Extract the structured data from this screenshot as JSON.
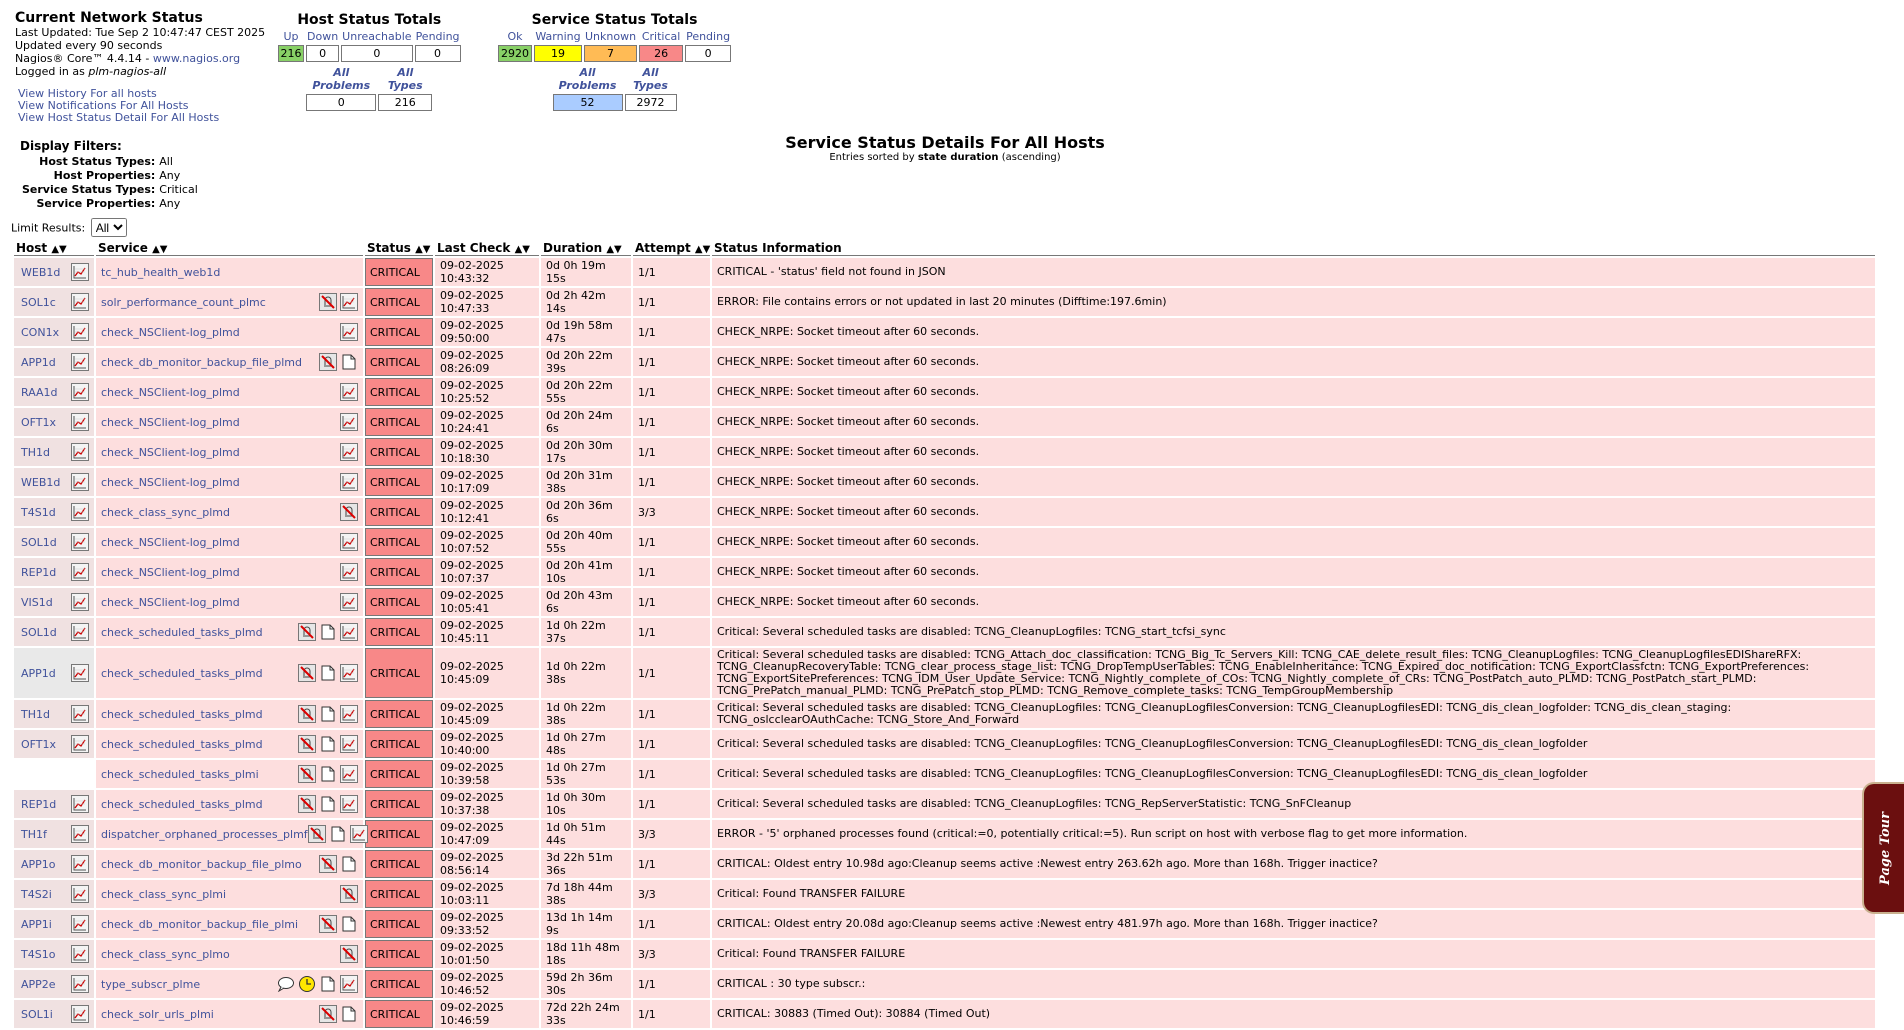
{
  "info": {
    "title": "Current Network Status",
    "last_updated": "Last Updated: Tue Sep 2 10:47:47 CEST 2025",
    "update_every": "Updated every 90 seconds",
    "version_prefix": "Nagios® Core™ 4.4.14 - ",
    "version_link": "www.nagios.org",
    "logged_prefix": "Logged in as ",
    "logged_user": "plm-nagios-all"
  },
  "links": [
    "View History For all hosts",
    "View Notifications For All Hosts",
    "View Host Status Detail For All Hosts"
  ],
  "host_totals": {
    "title": "Host Status Totals",
    "headers": [
      "Up",
      "Down",
      "Unreachable",
      "Pending"
    ],
    "values": [
      "216",
      "0",
      "0",
      "0"
    ],
    "sub_headers": [
      "All Problems",
      "All Types"
    ],
    "sub_values": [
      "0",
      "216"
    ]
  },
  "service_totals": {
    "title": "Service Status Totals",
    "headers": [
      "Ok",
      "Warning",
      "Unknown",
      "Critical",
      "Pending"
    ],
    "values": [
      "2920",
      "19",
      "7",
      "26",
      "0"
    ],
    "sub_headers": [
      "All Problems",
      "All Types"
    ],
    "sub_values": [
      "52",
      "2972"
    ]
  },
  "colors": {
    "ok": "#88d066",
    "warning": "#ffff00",
    "unknown": "#ffbb55",
    "critical": "#f88888",
    "problems": "#aaccff",
    "row_bg": "#fddede"
  },
  "filters": {
    "title": "Display Filters:",
    "rows": [
      {
        "k": "Host Status Types:",
        "v": "All"
      },
      {
        "k": "Host Properties:",
        "v": "Any"
      },
      {
        "k": "Service Status Types:",
        "v": "Critical"
      },
      {
        "k": "Service Properties:",
        "v": "Any"
      }
    ]
  },
  "heading": {
    "title": "Service Status Details For All Hosts",
    "sort_prefix": "Entries sorted by ",
    "sort_field": "state duration",
    "sort_suffix": " (ascending)"
  },
  "limit": {
    "label": "Limit Results:",
    "selected": "All"
  },
  "columns": [
    "Host",
    "Service",
    "Status",
    "Last Check",
    "Duration",
    "Attempt",
    "Status Information"
  ],
  "rows": [
    {
      "host": "WEB1d",
      "service": "tc_hub_health_web1d",
      "icons": [],
      "last": "09-02-2025 10:43:32",
      "dur": "0d 0h 19m 15s",
      "att": "1/1",
      "info": "CRITICAL - 'status' field not found in JSON",
      "hostbg": ""
    },
    {
      "host": "SOL1c",
      "service": "solr_performance_count_plmc",
      "icons": [
        "nonotif",
        "graph"
      ],
      "last": "09-02-2025 10:47:33",
      "dur": "0d 2h 42m 14s",
      "att": "1/1",
      "info": "ERROR: File contains errors or not updated in last 20 minutes (Difftime:197.6min)",
      "hostbg": ""
    },
    {
      "host": "CON1x",
      "service": "check_NSClient-log_plmd",
      "icons": [
        "graph"
      ],
      "last": "09-02-2025 09:50:00",
      "dur": "0d 19h 58m 47s",
      "att": "1/1",
      "info": "CHECK_NRPE: Socket timeout after 60 seconds.",
      "hostbg": ""
    },
    {
      "host": "APP1d",
      "service": "check_db_monitor_backup_file_plmd",
      "icons": [
        "nonotif",
        "doc"
      ],
      "last": "09-02-2025 08:26:09",
      "dur": "0d 20h 22m 39s",
      "att": "1/1",
      "info": "CHECK_NRPE: Socket timeout after 60 seconds.",
      "hostbg": ""
    },
    {
      "host": "RAA1d",
      "service": "check_NSClient-log_plmd",
      "icons": [
        "graph"
      ],
      "last": "09-02-2025 10:25:52",
      "dur": "0d 20h 22m 55s",
      "att": "1/1",
      "info": "CHECK_NRPE: Socket timeout after 60 seconds.",
      "hostbg": ""
    },
    {
      "host": "OFT1x",
      "service": "check_NSClient-log_plmd",
      "icons": [
        "graph"
      ],
      "last": "09-02-2025 10:24:41",
      "dur": "0d 20h 24m 6s",
      "att": "1/1",
      "info": "CHECK_NRPE: Socket timeout after 60 seconds.",
      "hostbg": ""
    },
    {
      "host": "TH1d",
      "service": "check_NSClient-log_plmd",
      "icons": [
        "graph"
      ],
      "last": "09-02-2025 10:18:30",
      "dur": "0d 20h 30m 17s",
      "att": "1/1",
      "info": "CHECK_NRPE: Socket timeout after 60 seconds.",
      "hostbg": ""
    },
    {
      "host": "WEB1d",
      "service": "check_NSClient-log_plmd",
      "icons": [
        "graph"
      ],
      "last": "09-02-2025 10:17:09",
      "dur": "0d 20h 31m 38s",
      "att": "1/1",
      "info": "CHECK_NRPE: Socket timeout after 60 seconds.",
      "hostbg": ""
    },
    {
      "host": "T4S1d",
      "service": "check_class_sync_plmd",
      "icons": [
        "nonotif"
      ],
      "last": "09-02-2025 10:12:41",
      "dur": "0d 20h 36m 6s",
      "att": "3/3",
      "info": "CHECK_NRPE: Socket timeout after 60 seconds.",
      "hostbg": ""
    },
    {
      "host": "SOL1d",
      "service": "check_NSClient-log_plmd",
      "icons": [
        "graph"
      ],
      "last": "09-02-2025 10:07:52",
      "dur": "0d 20h 40m 55s",
      "att": "1/1",
      "info": "CHECK_NRPE: Socket timeout after 60 seconds.",
      "hostbg": ""
    },
    {
      "host": "REP1d",
      "service": "check_NSClient-log_plmd",
      "icons": [
        "graph"
      ],
      "last": "09-02-2025 10:07:37",
      "dur": "0d 20h 41m 10s",
      "att": "1/1",
      "info": "CHECK_NRPE: Socket timeout after 60 seconds.",
      "hostbg": ""
    },
    {
      "host": "VIS1d",
      "service": "check_NSClient-log_plmd",
      "icons": [
        "graph"
      ],
      "last": "09-02-2025 10:05:41",
      "dur": "0d 20h 43m 6s",
      "att": "1/1",
      "info": "CHECK_NRPE: Socket timeout after 60 seconds.",
      "hostbg": ""
    },
    {
      "host": "SOL1d",
      "service": "check_scheduled_tasks_plmd",
      "icons": [
        "nonotif",
        "doc",
        "graph"
      ],
      "last": "09-02-2025 10:45:11",
      "dur": "1d 0h 22m 37s",
      "att": "1/1",
      "info": "Critical: Several scheduled tasks are disabled: TCNG_CleanupLogfiles: TCNG_start_tcfsi_sync",
      "hostbg": ""
    },
    {
      "host": "APP1d",
      "service": "check_scheduled_tasks_plmd",
      "icons": [
        "nonotif",
        "doc",
        "graph"
      ],
      "last": "09-02-2025 10:45:09",
      "dur": "1d 0h 22m 38s",
      "att": "1/1",
      "info": "Critical: Several scheduled tasks are disabled: TCNG_Attach_doc_classification: TCNG_Big_Tc_Servers_Kill: TCNG_CAE_delete_result_files: TCNG_CleanupLogfiles: TCNG_CleanupLogfilesEDIShareRFX: TCNG_CleanupRecoveryTable: TCNG_clear_process_stage_list: TCNG_DropTempUserTables: TCNG_EnableInheritance: TCNG_Expired_doc_notification: TCNG_ExportClassfctn: TCNG_ExportPreferences: TCNG_ExportSitePreferences: TCNG_IDM_User_Update_Service: TCNG_Nightly_complete_of_COs: TCNG_Nightly_complete_of_CRs: TCNG_PostPatch_auto_PLMD: TCNG_PostPatch_start_PLMD: TCNG_PrePatch_manual_PLMD: TCNG_PrePatch_stop_PLMD: TCNG_Remove_complete_tasks: TCNG_TempGroupMembership",
      "hostbg": "grey",
      "tall": 3
    },
    {
      "host": "TH1d",
      "service": "check_scheduled_tasks_plmd",
      "icons": [
        "nonotif",
        "doc",
        "graph"
      ],
      "last": "09-02-2025 10:45:09",
      "dur": "1d 0h 22m 38s",
      "att": "1/1",
      "info": "Critical: Several scheduled tasks are disabled: TCNG_CleanupLogfiles: TCNG_CleanupLogfilesConversion: TCNG_CleanupLogfilesEDI: TCNG_dis_clean_logfolder: TCNG_dis_clean_staging: TCNG_oslcclearOAuthCache: TCNG_Store_And_Forward",
      "hostbg": "",
      "tall": 2
    },
    {
      "host": "OFT1x",
      "service": "check_scheduled_tasks_plmd",
      "icons": [
        "nonotif",
        "doc",
        "graph"
      ],
      "last": "09-02-2025 10:40:00",
      "dur": "1d 0h 27m 48s",
      "att": "1/1",
      "info": "Critical: Several scheduled tasks are disabled: TCNG_CleanupLogfiles: TCNG_CleanupLogfilesConversion: TCNG_CleanupLogfilesEDI: TCNG_dis_clean_logfolder",
      "hostbg": "",
      "short": 1
    },
    {
      "host": "",
      "service": "check_scheduled_tasks_plmi",
      "icons": [
        "nonotif",
        "doc",
        "graph"
      ],
      "last": "09-02-2025 10:39:58",
      "dur": "1d 0h 27m 53s",
      "att": "1/1",
      "info": "Critical: Several scheduled tasks are disabled: TCNG_CleanupLogfiles: TCNG_CleanupLogfilesConversion: TCNG_CleanupLogfilesEDI: TCNG_dis_clean_logfolder",
      "hostbg": "",
      "short": 1
    },
    {
      "host": "REP1d",
      "service": "check_scheduled_tasks_plmd",
      "icons": [
        "nonotif",
        "doc",
        "graph"
      ],
      "last": "09-02-2025 10:37:38",
      "dur": "1d 0h 30m 10s",
      "att": "1/1",
      "info": "Critical: Several scheduled tasks are disabled: TCNG_CleanupLogfiles: TCNG_RepServerStatistic: TCNG_SnFCleanup",
      "hostbg": ""
    },
    {
      "host": "TH1f",
      "service": "dispatcher_orphaned_processes_plmf",
      "icons": [
        "nonotif",
        "doc",
        "graph"
      ],
      "last": "09-02-2025 10:47:09",
      "dur": "1d 0h 51m 44s",
      "att": "3/3",
      "info": "ERROR - '5' orphaned processes found (critical:=0, potentially critical:=5). Run script on host with verbose flag to get more information.",
      "hostbg": ""
    },
    {
      "host": "APP1o",
      "service": "check_db_monitor_backup_file_plmo",
      "icons": [
        "nonotif",
        "doc"
      ],
      "last": "09-02-2025 08:56:14",
      "dur": "3d 22h 51m 36s",
      "att": "1/1",
      "info": "CRITICAL: Oldest entry 10.98d ago:Cleanup seems active :Newest entry 263.62h ago. More than 168h. Trigger inactice?",
      "hostbg": ""
    },
    {
      "host": "T4S2i",
      "service": "check_class_sync_plmi",
      "icons": [
        "nonotif"
      ],
      "last": "09-02-2025 10:03:11",
      "dur": "7d 18h 44m 38s",
      "att": "3/3",
      "info": "Critical: Found TRANSFER FAILURE",
      "hostbg": ""
    },
    {
      "host": "APP1i",
      "service": "check_db_monitor_backup_file_plmi",
      "icons": [
        "nonotif",
        "doc"
      ],
      "last": "09-02-2025 09:33:52",
      "dur": "13d 1h 14m 9s",
      "att": "1/1",
      "info": "CRITICAL: Oldest entry 20.08d ago:Cleanup seems active :Newest entry 481.97h ago. More than 168h. Trigger inactice?",
      "hostbg": ""
    },
    {
      "host": "T4S1o",
      "service": "check_class_sync_plmo",
      "icons": [
        "nonotif"
      ],
      "last": "09-02-2025 10:01:50",
      "dur": "18d 11h 48m 18s",
      "att": "3/3",
      "info": "Critical: Found TRANSFER FAILURE",
      "hostbg": ""
    },
    {
      "host": "APP2e",
      "service": "type_subscr_plme",
      "icons": [
        "comment",
        "clock",
        "doc",
        "graph"
      ],
      "last": "09-02-2025 10:46:52",
      "dur": "59d 2h 36m 30s",
      "att": "1/1",
      "info": "CRITICAL : 30 type subscr.:",
      "hostbg": ""
    },
    {
      "host": "SOL1i",
      "service": "check_solr_urls_plmi",
      "icons": [
        "nonotif",
        "doc"
      ],
      "last": "09-02-2025 10:46:59",
      "dur": "72d 22h 24m 33s",
      "att": "1/1",
      "info": "CRITICAL: 30883 (Timed Out): 30884 (Timed Out)",
      "hostbg": ""
    }
  ],
  "status_label": "CRITICAL",
  "tour": "Page Tour"
}
